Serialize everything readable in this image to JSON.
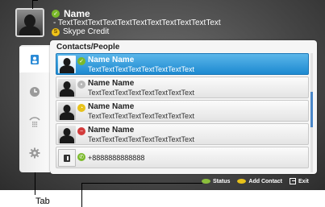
{
  "header": {
    "name": "Name",
    "mood": "- TextTextTextTextTextTextTextTextTextTextText",
    "credit": "Skype Credit",
    "credit_icon": "skype-s-icon",
    "status_icon": "online-check-icon"
  },
  "tabs": [
    {
      "icon": "contacts-icon",
      "active": true
    },
    {
      "icon": "clock-icon",
      "active": false
    },
    {
      "icon": "dialpad-icon",
      "active": false
    },
    {
      "icon": "gear-icon",
      "active": false
    }
  ],
  "panel": {
    "title": "Contacts/People",
    "contacts": [
      {
        "name": "Name Name",
        "mood": "TextTextTextTextTextTextTextText",
        "status": "online",
        "selected": true
      },
      {
        "name": "Name Name",
        "mood": "TextTextTextTextTextTextTextText",
        "status": "offline",
        "selected": false
      },
      {
        "name": "Name Name",
        "mood": "TextTextTextTextTextTextTextText",
        "status": "away",
        "selected": false
      },
      {
        "name": "Name Name",
        "mood": "TextTextTextTextTextTextTextText",
        "status": "busy",
        "selected": false
      }
    ],
    "phone": {
      "number": "+8888888888888",
      "status": "online"
    }
  },
  "footer": {
    "status_label": "Status",
    "add_contact_label": "Add Contact",
    "exit_label": "Exit"
  },
  "annotations": {
    "tab_caption": "Tab"
  },
  "colors": {
    "selected_row": "#1d8ad1",
    "online": "#7ab929",
    "away": "#e8c21a",
    "busy": "#d33b3b",
    "offline": "#b8b8b8"
  }
}
